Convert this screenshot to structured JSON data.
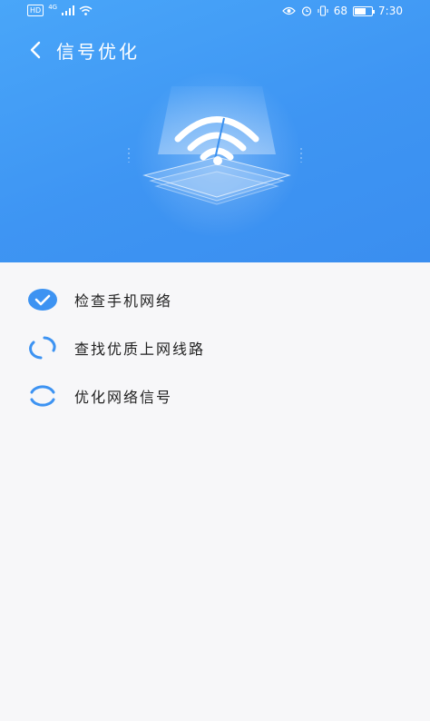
{
  "statusbar": {
    "left_badge": "HD",
    "network": "4G",
    "battery_text": "68",
    "battery_level": 0.68,
    "time": "7:30"
  },
  "header": {
    "title": "信号优化"
  },
  "steps": [
    {
      "label": "检查手机网络",
      "state": "done"
    },
    {
      "label": "查找优质上网线路",
      "state": "loading"
    },
    {
      "label": "优化网络信号",
      "state": "loading"
    }
  ],
  "colors": {
    "accent": "#3d93f2",
    "hero_top": "#49a6f9",
    "hero_bottom": "#3a8ef0",
    "background": "#f7f7f9"
  },
  "icons": {
    "back": "chevron-left-icon",
    "done": "check-circle-icon",
    "loading": "spinner-icon"
  }
}
